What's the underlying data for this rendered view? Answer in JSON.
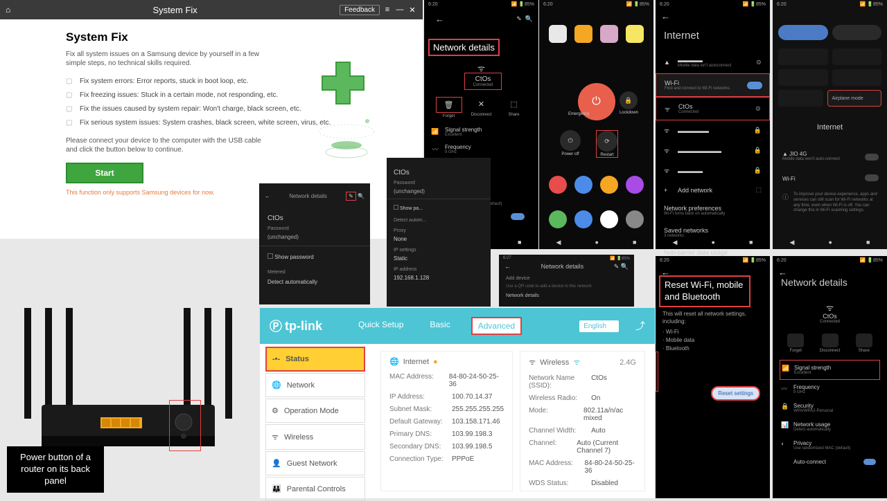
{
  "sysfix": {
    "window_title": "System Fix",
    "feedback": "Feedback",
    "heading": "System Fix",
    "desc": "Fix all system issues on a Samsung device by yourself in a few simple steps, no technical skills required.",
    "features": [
      "Fix system errors: Error reports, stuck in boot loop, etc.",
      "Fix freezing issues: Stuck in a certain mode, not responding, etc.",
      "Fix the issues caused by system repair: Won't charge, black screen, etc.",
      "Fix serious system issues: System crashes, black screen, white screen, virus, etc."
    ],
    "connect": "Please connect your device to the computer with the USB cable and click the button below to continue.",
    "start": "Start",
    "warn": "This function only supports Samsung devices for now."
  },
  "router_label": "Power button of a router on its back panel",
  "tplink": {
    "brand": "tp-link",
    "tabs": {
      "quick": "Quick Setup",
      "basic": "Basic",
      "advanced": "Advanced"
    },
    "lang": "English",
    "sidebar": [
      "Status",
      "Network",
      "Operation Mode",
      "Wireless",
      "Guest Network",
      "Parental Controls"
    ],
    "internet": {
      "title": "Internet",
      "rows": [
        [
          "MAC Address:",
          "84-80-24-50-25-36"
        ],
        [
          "IP Address:",
          "100.70.14.37"
        ],
        [
          "Subnet Mask:",
          "255.255.255.255"
        ],
        [
          "Default Gateway:",
          "103.158.171.46"
        ],
        [
          "Primary DNS:",
          "103.99.198.3"
        ],
        [
          "Secondary DNS:",
          "103.99.198.5"
        ],
        [
          "Connection Type:",
          "PPPoE"
        ]
      ]
    },
    "wireless": {
      "title": "Wireless",
      "band": "2.4G",
      "rows": [
        [
          "Network Name (SSID):",
          "CtOs"
        ],
        [
          "Wireless Radio:",
          "On"
        ],
        [
          "Mode:",
          "802.11a/n/ac mixed"
        ],
        [
          "Channel Width:",
          "Auto"
        ],
        [
          "Channel:",
          "Auto (Current Channel 7)"
        ],
        [
          "MAC Address:",
          "84-80-24-50-25-36"
        ],
        [
          "WDS Status:",
          "Disabled"
        ]
      ]
    }
  },
  "nd": {
    "title": "Network details",
    "ssid": "CtOs",
    "status": "Connected",
    "actions": {
      "forget": "Forget",
      "disconnect": "Disconnect",
      "share": "Share"
    },
    "rows": [
      {
        "t": "Signal strength",
        "s": "Excellent"
      },
      {
        "t": "Frequency",
        "s": "5 GHz"
      },
      {
        "t": "Security",
        "s": "WPA/WPA2-Personal"
      },
      {
        "t": "Network usage",
        "s": "Detect automatically"
      },
      {
        "t": "Privacy",
        "s": "Use randomized MAC (default)"
      }
    ],
    "autoconnect": "Auto-connect"
  },
  "pm": {
    "emergency": "Emergency",
    "lockdown": "Lockdown",
    "poweroff": "Power off",
    "restart": "Restart"
  },
  "internet": {
    "title": "Internet",
    "carrier_sub": "Mobile data isn't autoconnect",
    "wifi": "Wi-Fi",
    "wifi_sub": "Find and connect to Wi-Fi networks",
    "ssid": "CtOs",
    "ssid_sub": "Connected",
    "add": "Add network",
    "prefs": "Network preferences",
    "prefs_sub": "Wi-Fi turns back on automatically",
    "saved": "Saved networks",
    "saved_sub": "3 networks",
    "usage": "Non-carrier data usage"
  },
  "ns": {
    "internet": "Internet",
    "carrier": "JIO 4G",
    "carrier_sub": "Mobile data won't auto-connect",
    "wifi": "Wi-Fi",
    "airplane": "Airplane mode"
  },
  "edit": {
    "title": "Network details",
    "ssid": "CtOs",
    "password_lbl": "Password",
    "password_val": "(unchanged)",
    "showpw": "Show password",
    "metered": "Metered",
    "detect": "Detect automatically",
    "proxy": "Proxy",
    "none": "None",
    "ip": "IP settings",
    "static": "Static",
    "ipaddr": "IP address",
    "ipval": "192.168.1.128"
  },
  "rst": {
    "title": "Reset Wi-Fi, mobile and Bluetooth",
    "desc": "This will reset all network settings, including:",
    "items": [
      "· Wi-Fi",
      "· Mobile data",
      "· Bluetooth"
    ],
    "btn": "Reset settings"
  },
  "nd2": {
    "title": "Network details",
    "ssid": "CtOs",
    "status": "Connected",
    "actions": {
      "forget": "Forget",
      "disconnect": "Disconnect",
      "share": "Share"
    },
    "rows": [
      {
        "t": "Signal strength",
        "s": "Excellent"
      },
      {
        "t": "Frequency",
        "s": "5 GHz"
      },
      {
        "t": "Security",
        "s": "WPA/WPA2-Personal"
      },
      {
        "t": "Network usage",
        "s": "Detect automatically"
      },
      {
        "t": "Privacy",
        "s": "Use randomized MAC (default)"
      }
    ],
    "autoconnect": "Auto-connect"
  },
  "time": "6:20",
  "signal": "📶 🔋85%"
}
